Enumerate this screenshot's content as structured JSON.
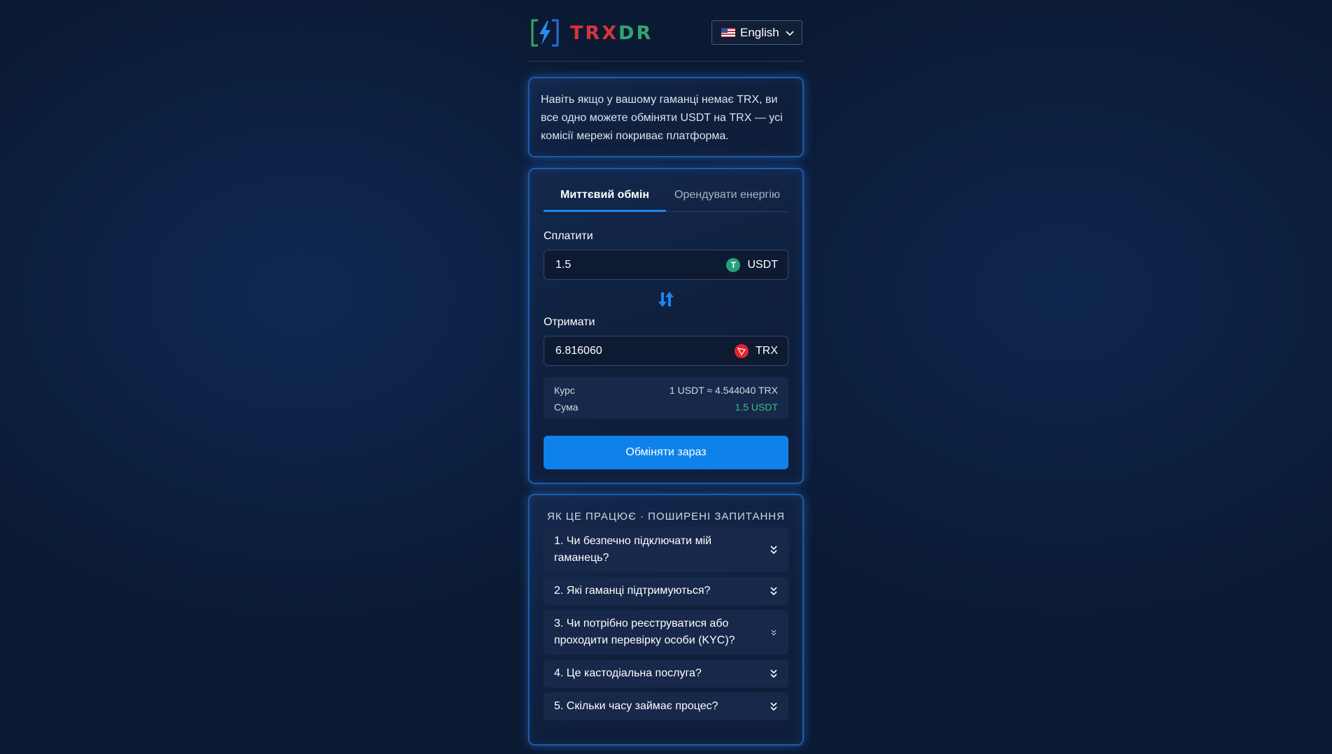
{
  "header": {
    "logo_text_part1": "TRX",
    "logo_text_part2": "DR",
    "language": "English",
    "flag_icon": "us-flag-icon"
  },
  "info": {
    "text": "Навіть якщо у вашому гаманці немає TRX, ви все одно можете обміняти USDT на TRX — усі комісії мережі покриває платформа."
  },
  "exchange": {
    "tabs": [
      {
        "label": "Миттєвий обмін",
        "active": true
      },
      {
        "label": "Орендувати енергію",
        "active": false
      }
    ],
    "pay_label": "Сплатити",
    "pay_value": "1.5",
    "pay_coin": "USDT",
    "pay_coin_icon": "tether-icon",
    "swap_icon": "swap-arrows-icon",
    "receive_label": "Отримати",
    "receive_value": "6.816060",
    "receive_coin": "TRX",
    "receive_coin_icon": "tron-icon",
    "rate_label": "Курс",
    "rate_value": "1 USDT ≈ 4.544040 TRX",
    "sum_label": "Сума",
    "sum_value": "1.5 USDT",
    "button_label": "Обміняти зараз",
    "colors": {
      "accent": "#0e82ea",
      "green": "#33c47a",
      "border": "#1f5ca8"
    }
  },
  "faq": {
    "title": "ЯК ЦЕ ПРАЦЮЄ · ПОШИРЕНІ ЗАПИТАННЯ",
    "items": [
      "1. Чи безпечно підключати мій гаманець?",
      "2. Які гаманці підтримуються?",
      "3. Чи потрібно реєструватися або проходити перевірку особи (KYC)?",
      "4. Це кастодіальна послуга?",
      "5. Скільки часу займає процес?"
    ]
  }
}
